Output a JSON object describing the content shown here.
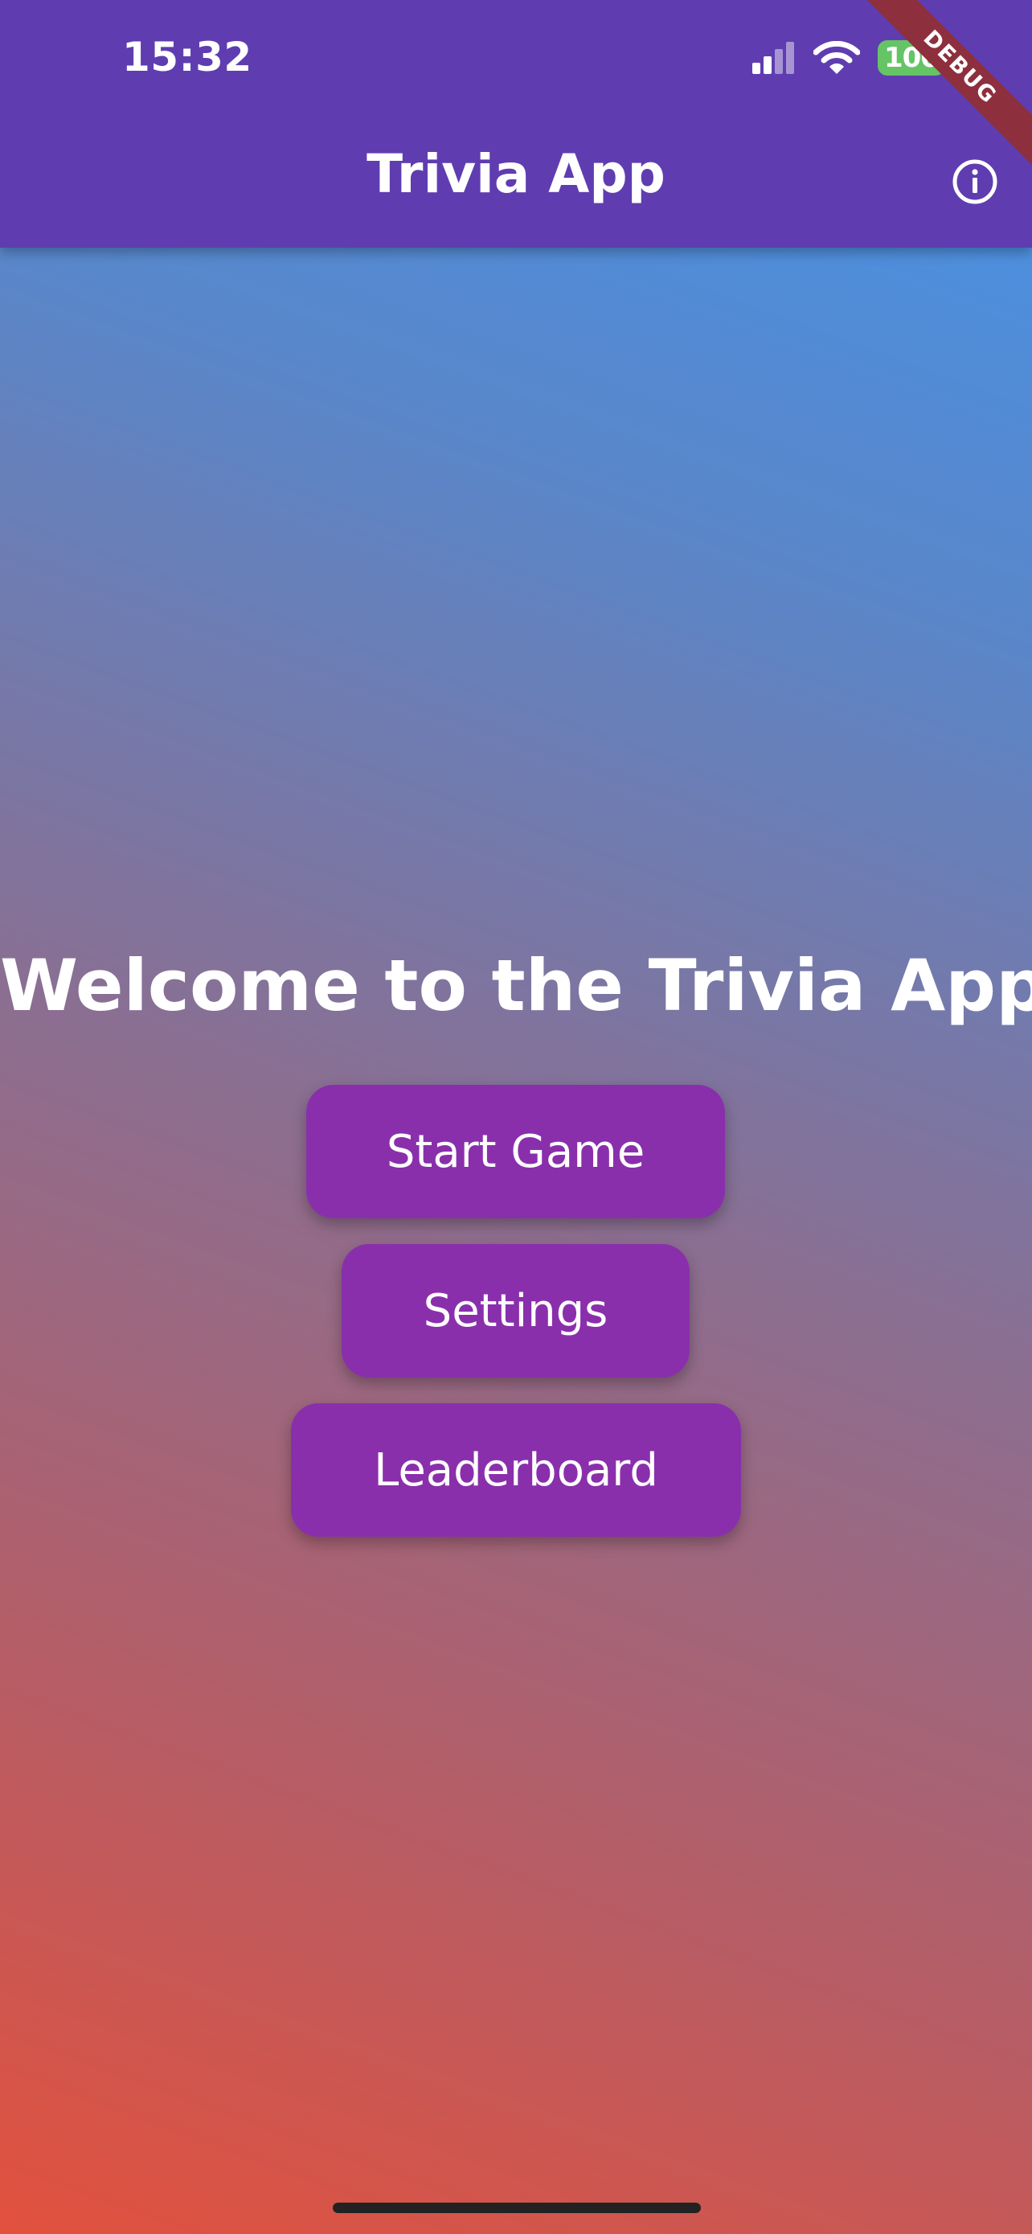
{
  "status_bar": {
    "time": "15:32",
    "battery_level": "100",
    "signal_icon": "cellular-signal-icon",
    "wifi_icon": "wifi-icon"
  },
  "app_bar": {
    "title": "Trivia App",
    "info_icon": "info-icon"
  },
  "debug_banner": {
    "label": "DEBUG"
  },
  "main": {
    "welcome_text": "Welcome to the Trivia App",
    "buttons": [
      {
        "label": "Start Game"
      },
      {
        "label": "Settings"
      },
      {
        "label": "Leaderboard"
      }
    ]
  },
  "colors": {
    "app_bar": "#5f3db0",
    "button": "#8a2fac",
    "gradient_top": "#4594ea",
    "gradient_bottom": "#e2513d",
    "battery": "#65c466",
    "debug_ribbon": "#8e2f3e"
  }
}
